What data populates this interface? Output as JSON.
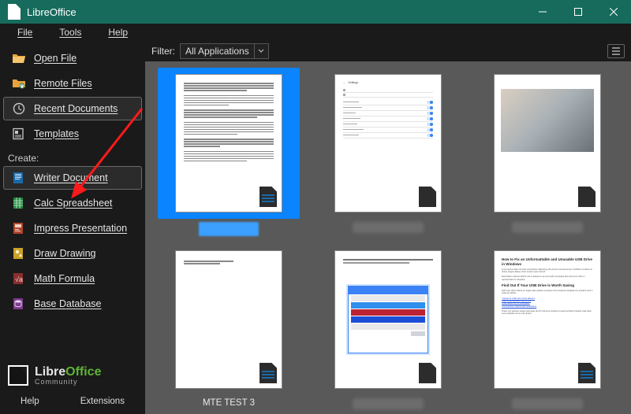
{
  "titlebar": {
    "title": "LibreOffice"
  },
  "menubar": {
    "file": "File",
    "tools": "Tools",
    "help": "Help"
  },
  "sidebar": {
    "open_file": "Open File",
    "remote_files": "Remote Files",
    "recent_docs": "Recent Documents",
    "templates": "Templates",
    "create_label": "Create:",
    "writer": "Writer Document",
    "calc": "Calc Spreadsheet",
    "impress": "Impress Presentation",
    "draw": "Draw Drawing",
    "math": "Math Formula",
    "base": "Base Database"
  },
  "brand": {
    "libre": "Libre",
    "office": "Office",
    "community": "Community"
  },
  "footer": {
    "help": "Help",
    "extensions": "Extensions"
  },
  "filter": {
    "label": "Filter:",
    "value": "All Applications"
  },
  "docs": {
    "d4_label": "MTE TEST 3",
    "d6_title1": "How to Fix an Unformattable and Unusable USB Drive in Windows",
    "d6_title2": "Find Out If Your USB Drive is Worth Saving"
  },
  "colors": {
    "accent": "#166b5c",
    "selection": "#0a84ff",
    "annotation": "#ff1a1a"
  }
}
